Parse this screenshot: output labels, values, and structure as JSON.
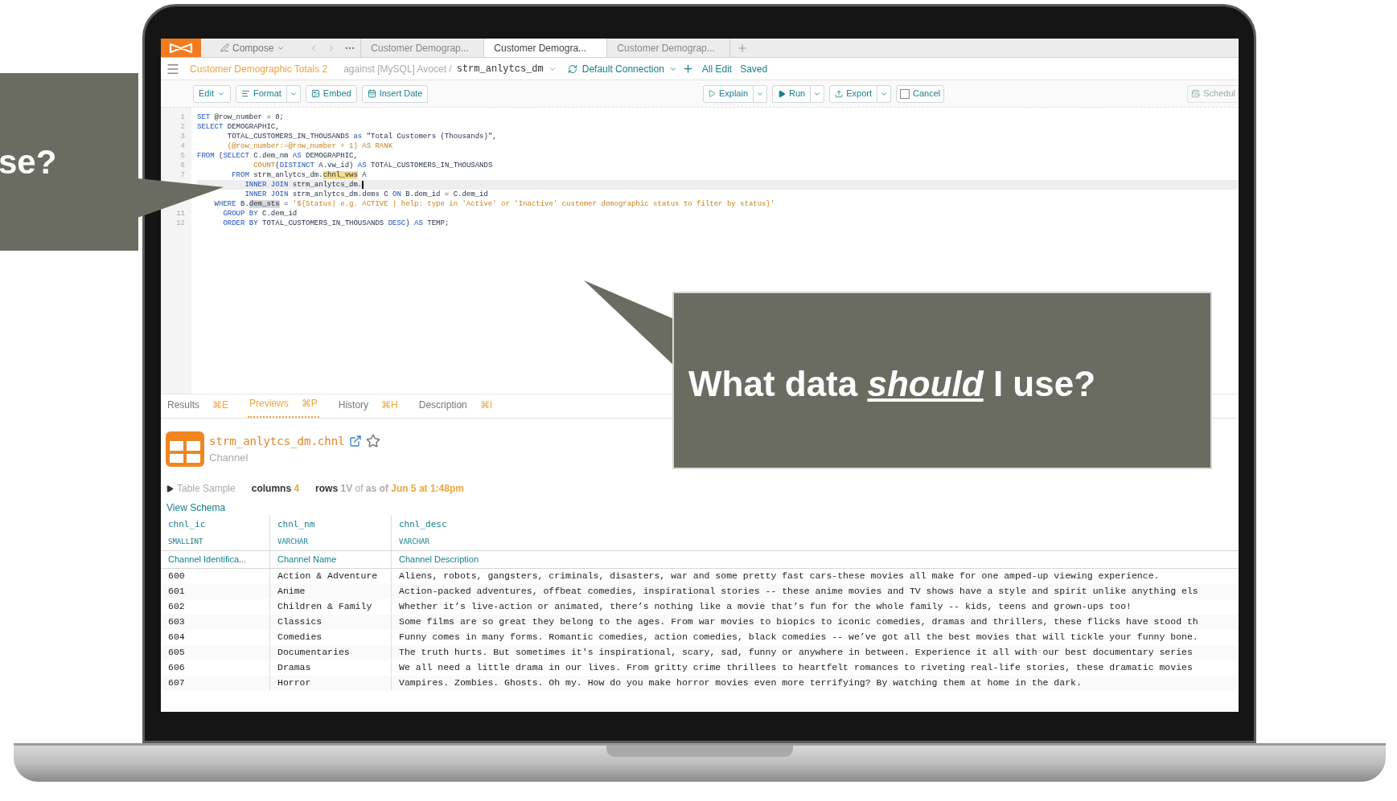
{
  "app_bar": {
    "compose": "Compose",
    "tabs": [
      {
        "label": "Customer Demograp...",
        "selected": false
      },
      {
        "label": "Customer Demogra...",
        "selected": true
      },
      {
        "label": "Customer Demograp...",
        "selected": false
      }
    ]
  },
  "query_bar": {
    "title": "Customer Demographic Totals 2",
    "against": "against [MySQL] Avocet /",
    "database": "strm_anlytcs_dm",
    "connection": "Default Connection",
    "actions": [
      "All Edit",
      "Saved"
    ]
  },
  "toolbar": {
    "left": [
      {
        "label": "Edit",
        "kind": "dropdown"
      },
      {
        "label": "Format",
        "kind": "split"
      },
      {
        "label": "Embed",
        "kind": "plain"
      },
      {
        "label": "Insert Date",
        "kind": "plain"
      }
    ],
    "right": [
      {
        "label": "Explain",
        "kind": "split"
      },
      {
        "label": "Run",
        "kind": "split"
      },
      {
        "label": "Export",
        "kind": "split"
      },
      {
        "label": "Cancel",
        "kind": "checkbox"
      }
    ],
    "schedule": "Schedul"
  },
  "editor": {
    "lines": [
      {
        "number": "1",
        "current": false,
        "segments": [
          {
            "text": "SET",
            "kind": "kw"
          },
          {
            "text": " @row_number = 0;",
            "kind": "pl"
          }
        ]
      },
      {
        "number": "2",
        "current": false,
        "segments": [
          {
            "text": "SELECT",
            "kind": "kw"
          },
          {
            "text": " DEMOGRAPHIC,",
            "kind": "pl"
          }
        ]
      },
      {
        "number": "3",
        "current": false,
        "segments": [
          {
            "text": "       TOTAL_CUSTOMERS_IN_THOUSANDS ",
            "kind": "pl"
          },
          {
            "text": "as",
            "kind": "kw"
          },
          {
            "text": " \"Total Customers (Thousands)\",",
            "kind": "pl"
          }
        ]
      },
      {
        "number": "4",
        "current": false,
        "segments": [
          {
            "text": "       (@row_number:=@row_number + 1) AS RANK",
            "kind": "str"
          }
        ]
      },
      {
        "number": "5",
        "current": false,
        "segments": [
          {
            "text": "FROM",
            "kind": "kw"
          },
          {
            "text": " (",
            "kind": "pl"
          },
          {
            "text": "SELECT",
            "kind": "kw"
          },
          {
            "text": " C.dem_nm ",
            "kind": "pl"
          },
          {
            "text": "AS",
            "kind": "kw"
          },
          {
            "text": " DEMOGRAPHIC,",
            "kind": "pl"
          }
        ]
      },
      {
        "number": "6",
        "current": false,
        "segments": [
          {
            "text": "             COUNT",
            "kind": "str"
          },
          {
            "text": "(",
            "kind": "pl"
          },
          {
            "text": "DISTINCT",
            "kind": "kw"
          },
          {
            "text": " A.vw_id) ",
            "kind": "pl"
          },
          {
            "text": "AS",
            "kind": "kw"
          },
          {
            "text": " TOTAL_CUSTOMERS_IN_THOUSANDS",
            "kind": "pl"
          }
        ]
      },
      {
        "number": "7",
        "current": false,
        "segments": [
          {
            "text": "        FROM",
            "kind": "kw"
          },
          {
            "text": " strm_anlytcs_dm.",
            "kind": "pl"
          },
          {
            "text": "chnl_vws",
            "kind": "hl"
          },
          {
            "text": " A",
            "kind": "pl"
          }
        ]
      },
      {
        "current": true,
        "segments": [
          {
            "text": "           INNER JOIN",
            "kind": "kw"
          },
          {
            "text": " strm_anlytcs_dm.",
            "kind": "pl"
          }
        ]
      },
      {
        "current": false,
        "segments": [
          {
            "text": "           INNER JOIN",
            "kind": "kw"
          },
          {
            "text": " strm_anlytcs_dm.dems C ",
            "kind": "pl"
          },
          {
            "text": "ON",
            "kind": "kw"
          },
          {
            "text": " B.dem_id = C.dem_id",
            "kind": "pl"
          }
        ]
      },
      {
        "current": false,
        "segments": [
          {
            "text": "    WHERE",
            "kind": "kw"
          },
          {
            "text": " B.",
            "kind": "pl"
          },
          {
            "text": "dem_sts",
            "kind": "sel"
          },
          {
            "text": " = ",
            "kind": "pl"
          },
          {
            "text": "'${Status| e.g. ACTIVE | help: type in 'Active' or 'Inactive' customer demographic status to filter by status}'",
            "kind": "str"
          }
        ]
      },
      {
        "number": "11",
        "current": false,
        "segments": [
          {
            "text": "      GROUP BY",
            "kind": "kw"
          },
          {
            "text": " C.dem_id",
            "kind": "pl"
          }
        ]
      },
      {
        "number": "12",
        "current": false,
        "segments": [
          {
            "text": "      ORDER BY",
            "kind": "kw"
          },
          {
            "text": " TOTAL_CUSTOMERS_IN_THOUSANDS ",
            "kind": "pl"
          },
          {
            "text": "DESC",
            "kind": "kw"
          },
          {
            "text": ") ",
            "kind": "pl"
          },
          {
            "text": "AS",
            "kind": "kw"
          },
          {
            "text": " TEMP;",
            "kind": "pl"
          }
        ]
      }
    ]
  },
  "result_tabs": [
    {
      "label": "Results",
      "shortcut": "⌘E",
      "selected": false
    },
    {
      "label": "Previews",
      "shortcut": "⌘P",
      "selected": true
    },
    {
      "label": "History",
      "shortcut": "⌘H",
      "selected": false
    },
    {
      "label": "Description",
      "shortcut": "⌘I",
      "selected": false
    }
  ],
  "preview": {
    "table_name": "strm_anlytcs_dm.chnl",
    "subtitle": "Channel",
    "favorite": false,
    "sample": {
      "label": "Table Sample",
      "expanded": false,
      "columns_label": "columns",
      "columns_value": "4",
      "rows_label": "rows",
      "rows_value": "1V",
      "of": "of",
      "as_of": "as of",
      "timestamp": "Jun 5 at 1:48pm"
    },
    "view_schema": "View Schema",
    "columns": [
      {
        "name": "chnl_ic",
        "type": "SMALLINT",
        "description": "Channel Identifica..."
      },
      {
        "name": "chnl_nm",
        "type": "VARCHAR",
        "description": "Channel Name"
      },
      {
        "name": "chnl_desc",
        "type": "VARCHAR",
        "description": "Channel Description"
      }
    ],
    "rows": [
      [
        "600",
        "Action & Adventure",
        "Aliens, robots, gangsters, criminals, disasters, war and some pretty fast cars-these movies all make for one amped-up viewing experience."
      ],
      [
        "601",
        "Anime",
        "Action-packed adventures, offbeat comedies, inspirational stories -- these anime movies and TV shows have a style and spirit unlike anything els"
      ],
      [
        "602",
        "Children & Family",
        "Whether it’s live-action or animated, there’s nothing like a movie that’s fun for the whole family -- kids, teens and grown-ups too!"
      ],
      [
        "603",
        "Classics",
        "Some films are so great they belong to the ages. From war movies to biopics to iconic comedies, dramas and thrillers, these flicks have stood th"
      ],
      [
        "604",
        "Comedies",
        "Funny comes in many forms. Romantic comedies, action comedies, black comedies -- we’ve got all the best movies that will tickle your funny bone."
      ],
      [
        "605",
        "Documentaries",
        "The truth hurts. But sometimes it's inspirational, scary, sad, funny or anywhere in between. Experience it all with our best documentary series"
      ],
      [
        "606",
        "Dramas",
        "We all need a little drama in our lives. From gritty crime thrillees to heartfelt romances to riveting real-life stories, these dramatic movies"
      ],
      [
        "607",
        "Horror",
        "Vampires. Zombies. Ghosts. Oh my. How do you make horror movies even more terrifying? By watching them at home in the dark."
      ]
    ]
  },
  "callouts": [
    {
      "text": "se?"
    },
    {
      "text": "What data *should* I use?"
    }
  ]
}
